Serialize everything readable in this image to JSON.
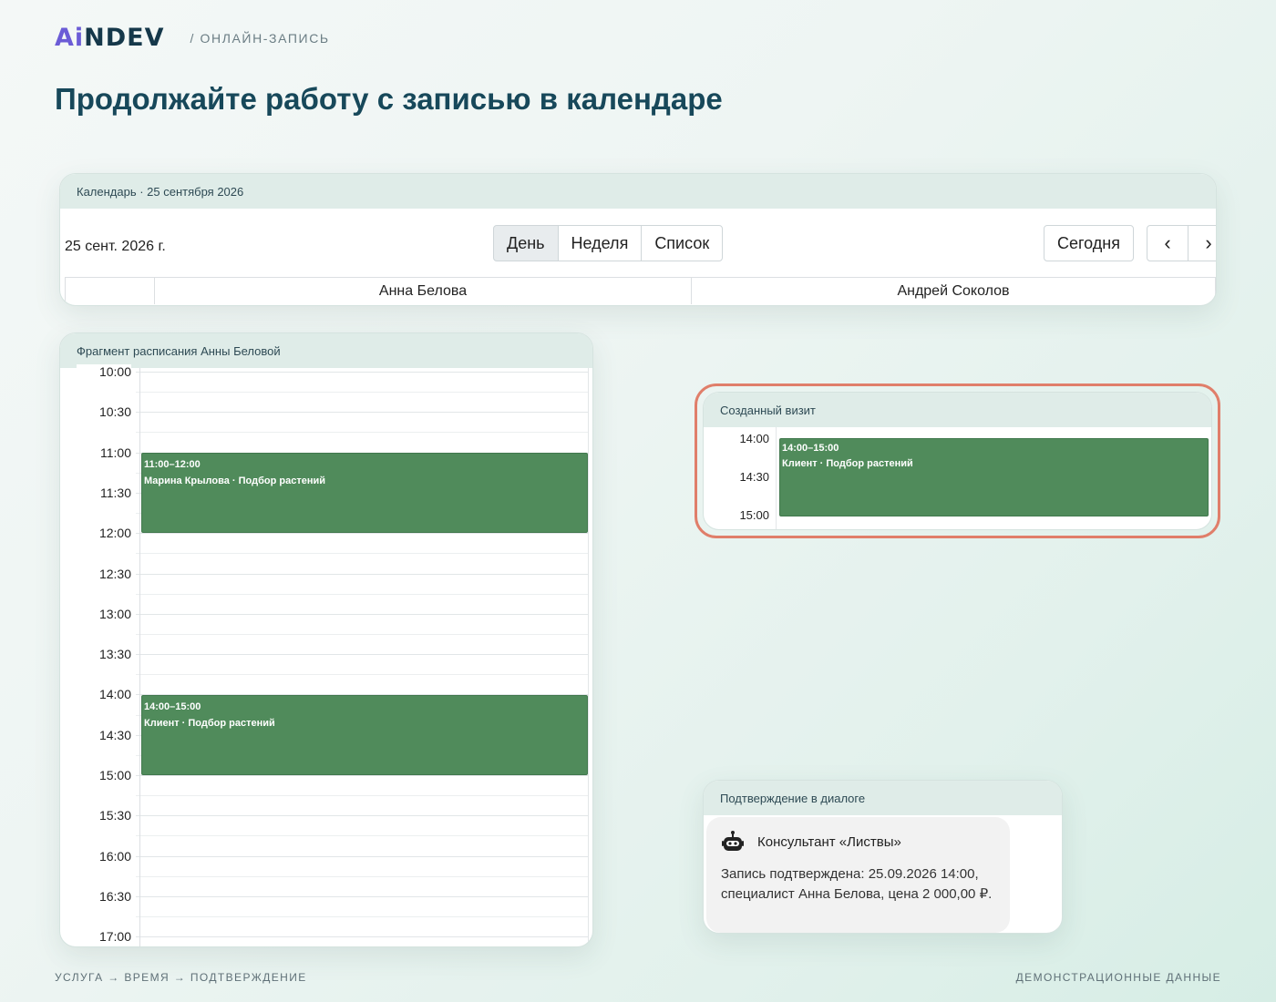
{
  "header": {
    "logo_prefix": "Ai",
    "logo_suffix": "NDEV",
    "section": "/ ОНЛАЙН-ЗАПИСЬ"
  },
  "page_title": "Продолжайте работу с записью в календаре",
  "calendar_card": {
    "title": "Календарь · 25 сентября 2026",
    "date": "25 сент. 2026 г.",
    "views": [
      "День",
      "Неделя",
      "Список"
    ],
    "active_view": "День",
    "today": "Сегодня",
    "prev": "‹",
    "next": "›",
    "resources": [
      "Анна Белова",
      "Андрей Соколов"
    ]
  },
  "schedule_card": {
    "title": "Фрагмент расписания Анны Беловой",
    "times": [
      "10:00",
      "10:30",
      "11:00",
      "11:30",
      "12:00",
      "12:30",
      "13:00",
      "13:30",
      "14:00",
      "14:30",
      "15:00",
      "15:30",
      "16:00",
      "16:30",
      "17:00"
    ],
    "events": [
      {
        "time": "11:00–12:00",
        "label": "Марина Крылова · Подбор растений"
      },
      {
        "time": "14:00–15:00",
        "label": "Клиент · Подбор растений"
      }
    ]
  },
  "visit_card": {
    "title": "Созданный визит",
    "times": [
      "14:00",
      "14:30",
      "15:00"
    ],
    "event": {
      "time": "14:00–15:00",
      "label": "Клиент · Подбор растений"
    }
  },
  "dialog_card": {
    "title": "Подтверждение в диалоге",
    "sender": "Консультант «Листвы»",
    "message": "Запись подтверждена: 25.09.2026 14:00, специалист Анна Белова, цена 2 000,00 ₽."
  },
  "footer": {
    "steps": "УСЛУГА → ВРЕМЯ → ПОДТВЕРЖДЕНИЕ",
    "note": "ДЕМОНСТРАЦИОННЫЕ ДАННЫЕ"
  },
  "colors": {
    "event": "#508b5b",
    "highlight": "#e07e6a",
    "title": "#17485a",
    "logo_accent": "#6b5cd6"
  }
}
